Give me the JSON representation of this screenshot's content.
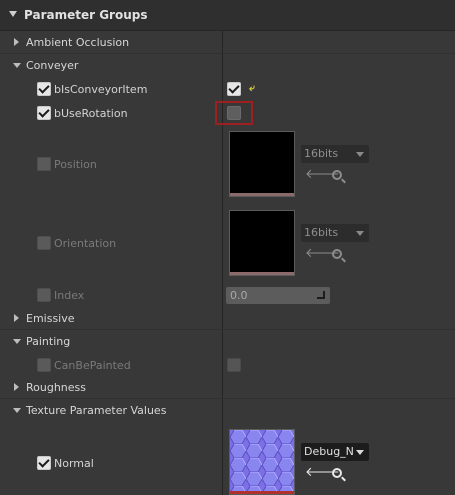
{
  "header": {
    "title": "Parameter Groups"
  },
  "categories": {
    "ambient_occlusion": "Ambient Occlusion",
    "conveyer": "Conveyer",
    "emissive": "Emissive",
    "painting": "Painting",
    "roughness": "Roughness",
    "texture_parameter_values": "Texture Parameter Values"
  },
  "conveyer": {
    "bIsConveyorItem": {
      "label": "bIsConveyorItem",
      "checked": true,
      "value_checked": true
    },
    "bUseRotation": {
      "label": "bUseRotation",
      "checked": true,
      "value_checked": false
    },
    "position": {
      "label": "Position",
      "compression": "16bits"
    },
    "orientation": {
      "label": "Orientation",
      "compression": "16bits"
    },
    "index": {
      "label": "Index",
      "value": "0.0"
    }
  },
  "painting": {
    "can_be_painted": {
      "label": "CanBePainted"
    }
  },
  "texture_parameter_values": {
    "normal": {
      "label": "Normal",
      "texture": "Debug_N"
    }
  },
  "icons": {
    "reset": "reset-to-default-icon",
    "use_selected": "left-arrow-icon",
    "browse": "search-icon"
  },
  "colors": {
    "panel_bg": "#383838",
    "highlight": "#9d1f1f",
    "reset_icon": "#e2d34a",
    "normal_texture": "#7d6fe2"
  }
}
